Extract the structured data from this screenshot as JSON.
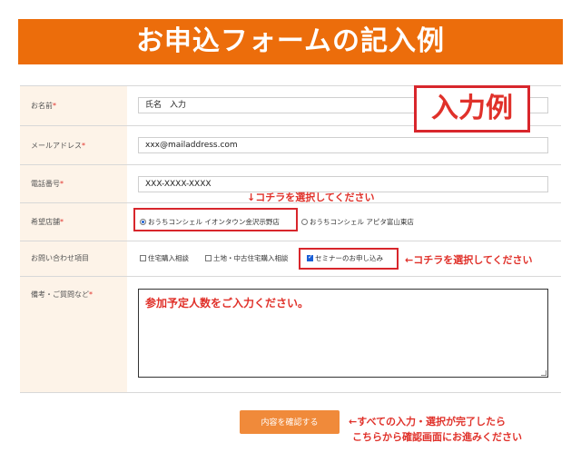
{
  "banner": {
    "title": "お申込フォームの記入例"
  },
  "example_tag": "入力例",
  "fields": {
    "name": {
      "label": "お名前",
      "required_mark": "*",
      "value": "氏名　入力"
    },
    "email": {
      "label": "メールアドレス",
      "required_mark": "*",
      "value": "xxx@mailaddress.com"
    },
    "phone": {
      "label": "電話番号",
      "required_mark": "*",
      "value": "XXX-XXXX-XXXX"
    },
    "store": {
      "label": "希望店舗",
      "required_mark": "*",
      "options": [
        {
          "label": "おうちコンシェル イオンタウン金沢示野店",
          "checked": true
        },
        {
          "label": "おうちコンシェル アピタ富山東店",
          "checked": false
        }
      ]
    },
    "inquiry": {
      "label": "お問い合わせ項目",
      "options": [
        {
          "label": "住宅購入相談",
          "checked": false
        },
        {
          "label": "土地・中古住宅購入相談",
          "checked": false
        },
        {
          "label": "セミナーのお申し込み",
          "checked": true
        }
      ]
    },
    "notes": {
      "label": "備考・ご質問など",
      "required_mark": "*",
      "value": "参加予定人数をご入力ください。"
    }
  },
  "annotations": {
    "store_hint": "↓コチラを選択してください",
    "inquiry_hint": "←コチラを選択してください",
    "submit_hint_line1": "←すべての入力・選択が完了したら",
    "submit_hint_line2": "こちらから確認画面にお進みください"
  },
  "submit": {
    "label": "内容を確認する"
  },
  "colors": {
    "accent": "#ec6d0b",
    "highlight": "#d8262c",
    "label_bg": "#fdf3e8",
    "button": "#f08a3a"
  }
}
